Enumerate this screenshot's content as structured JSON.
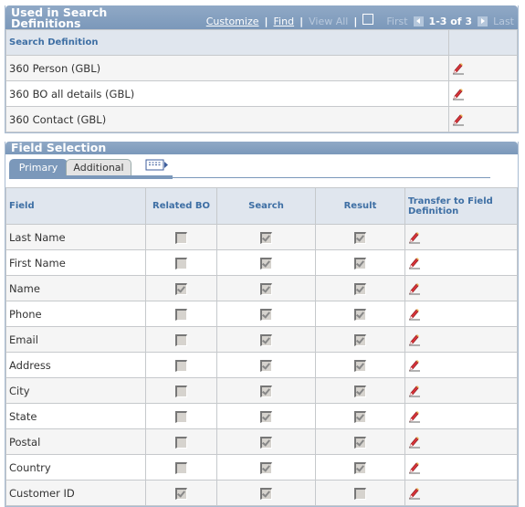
{
  "search_defs": {
    "title": "Used in Search Definitions",
    "nav": {
      "customize": "Customize",
      "find": "Find",
      "view_all": "View All",
      "first": "First",
      "count": "1-3 of 3",
      "last": "Last",
      "popout_icon": "new-window-icon"
    },
    "column_headers": [
      "Search Definition",
      ""
    ],
    "rows": [
      {
        "name": "360 Person (GBL)",
        "edit_icon": "pencil-edit-icon"
      },
      {
        "name": "360 BO all details (GBL)",
        "edit_icon": "pencil-edit-icon"
      },
      {
        "name": "360 Contact (GBL)",
        "edit_icon": "pencil-edit-icon"
      }
    ]
  },
  "field_selection": {
    "title": "Field Selection",
    "tabs": [
      {
        "label": "Primary",
        "active": true
      },
      {
        "label": "Additional",
        "active": false
      }
    ],
    "show_all_columns_icon": "show-all-columns-icon",
    "column_headers": [
      "Field",
      "Related BO",
      "Search",
      "Result",
      "Transfer to Field Definition"
    ],
    "rows": [
      {
        "field": "Last Name",
        "related_bo": false,
        "search": true,
        "result": true
      },
      {
        "field": "First Name",
        "related_bo": false,
        "search": true,
        "result": true
      },
      {
        "field": "Name",
        "related_bo": true,
        "search": true,
        "result": true
      },
      {
        "field": "Phone",
        "related_bo": false,
        "search": true,
        "result": true
      },
      {
        "field": "Email",
        "related_bo": false,
        "search": true,
        "result": true
      },
      {
        "field": "Address",
        "related_bo": false,
        "search": true,
        "result": true
      },
      {
        "field": "City",
        "related_bo": false,
        "search": true,
        "result": true
      },
      {
        "field": "State",
        "related_bo": false,
        "search": true,
        "result": true
      },
      {
        "field": "Postal",
        "related_bo": false,
        "search": true,
        "result": true
      },
      {
        "field": "Country",
        "related_bo": false,
        "search": true,
        "result": true
      },
      {
        "field": "Customer ID",
        "related_bo": true,
        "search": true,
        "result": false
      }
    ]
  }
}
